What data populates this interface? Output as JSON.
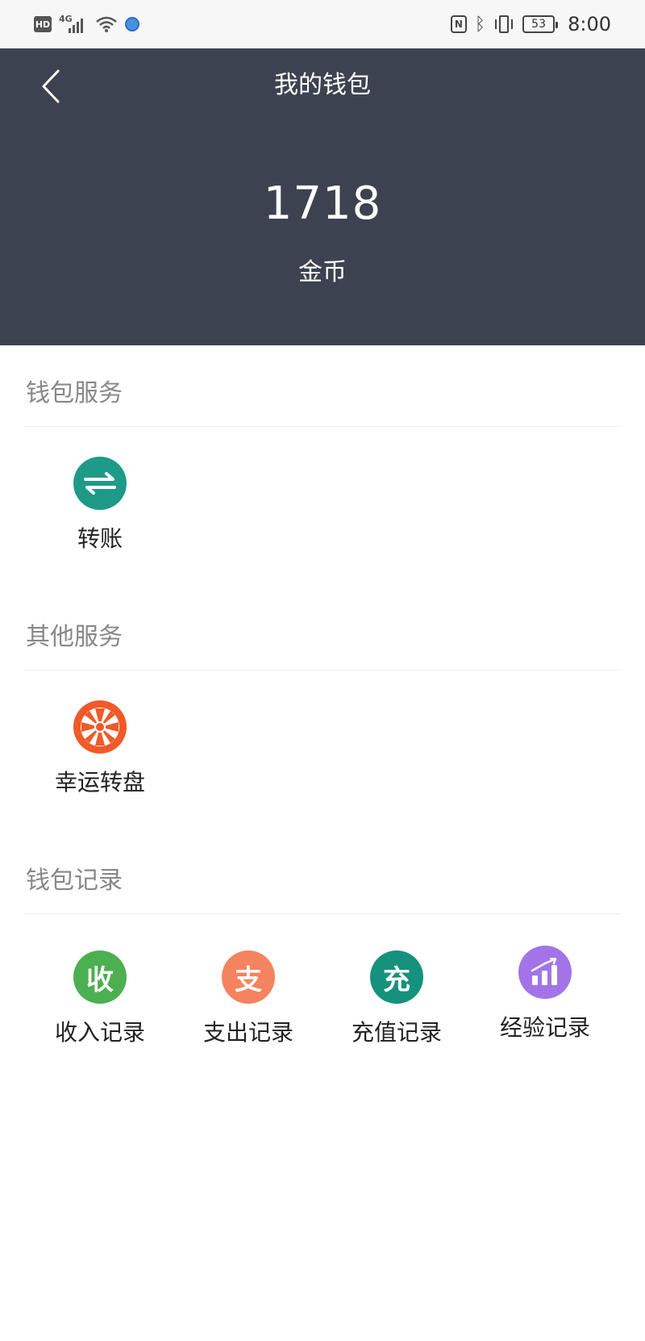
{
  "status_bar": {
    "hd": "HD",
    "network": "4G",
    "nfc": "N",
    "battery": "53",
    "time": "8:00"
  },
  "header": {
    "title": "我的钱包",
    "balance": "1718",
    "balance_unit": "金币"
  },
  "sections": {
    "wallet_services": {
      "title": "钱包服务",
      "items": [
        {
          "label": "转账",
          "icon": "transfer-icon",
          "color": "#1e9a88"
        }
      ]
    },
    "other_services": {
      "title": "其他服务",
      "items": [
        {
          "label": "幸运转盘",
          "icon": "lucky-wheel-icon",
          "color": "#f05a28"
        }
      ]
    },
    "wallet_records": {
      "title": "钱包记录",
      "items": [
        {
          "label": "收入记录",
          "glyph": "收",
          "icon": "income-icon",
          "color": "#4caf50"
        },
        {
          "label": "支出记录",
          "glyph": "支",
          "icon": "expense-icon",
          "color": "#f4845f"
        },
        {
          "label": "充值记录",
          "glyph": "充",
          "icon": "recharge-icon",
          "color": "#16917e"
        },
        {
          "label": "经验记录",
          "icon": "experience-chart-icon",
          "color": "#a274e8"
        }
      ]
    }
  }
}
